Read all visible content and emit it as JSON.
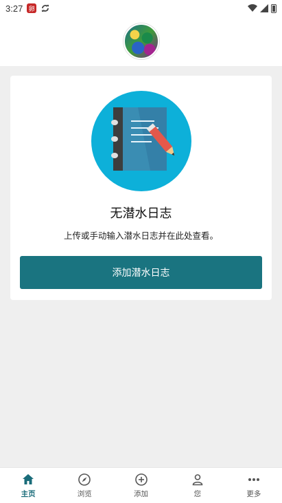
{
  "status_bar": {
    "time": "3:27",
    "app_badge": "卵"
  },
  "empty_state": {
    "title": "无潜水日志",
    "description": "上传或手动输入潜水日志并在此处查看。",
    "button_label": "添加潜水日志"
  },
  "colors": {
    "accent": "#1a7480",
    "illustration_circle": "#0db0d9",
    "nav_active": "#1a6c7a"
  },
  "nav": {
    "items": [
      {
        "label": "主页",
        "icon": "home-icon",
        "active": true
      },
      {
        "label": "浏览",
        "icon": "compass-icon",
        "active": false
      },
      {
        "label": "添加",
        "icon": "plus-circle-icon",
        "active": false
      },
      {
        "label": "您",
        "icon": "person-icon",
        "active": false
      },
      {
        "label": "更多",
        "icon": "more-icon",
        "active": false
      }
    ]
  }
}
